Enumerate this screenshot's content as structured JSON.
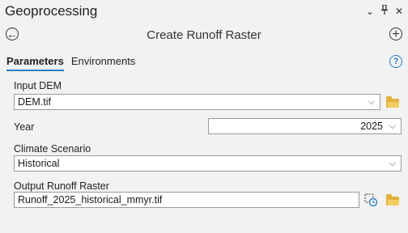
{
  "pane": {
    "title": "Geoprocessing",
    "ctrl_dropdown": "⌄",
    "ctrl_pin": "⊥",
    "ctrl_close": "✕"
  },
  "tool": {
    "title": "Create Runoff Raster",
    "back_glyph": "←",
    "add_glyph": "+"
  },
  "tabs": {
    "parameters": "Parameters",
    "environments": "Environments",
    "help_glyph": "?"
  },
  "params": {
    "input_dem": {
      "label": "Input DEM",
      "value": "DEM.tif"
    },
    "year": {
      "label": "Year",
      "value": "2025"
    },
    "climate": {
      "label": "Climate Scenario",
      "value": "Historical"
    },
    "output": {
      "label": "Output Runoff Raster",
      "value": "Runoff_2025_historical_mmyr.tif"
    }
  },
  "icons": {
    "chevron": "chevron-down-icon",
    "folder": "folder-icon",
    "output_options": "output-options-icon"
  },
  "colors": {
    "tab_accent": "#2d7bc0",
    "folder": "#e0b23e"
  }
}
